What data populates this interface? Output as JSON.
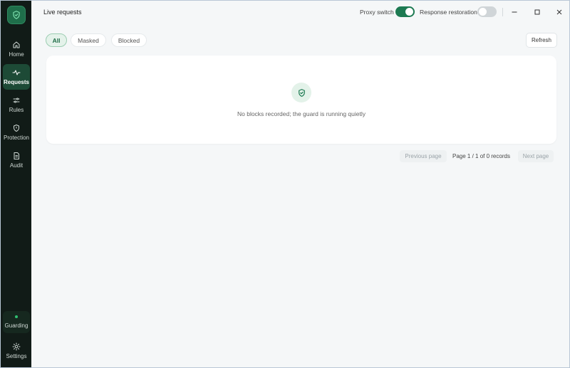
{
  "window": {
    "title": "Live requests",
    "controls": {
      "minimize": "minimize-icon",
      "maximize": "maximize-icon",
      "close": "close-icon"
    }
  },
  "header": {
    "proxy_switch": {
      "label": "Proxy switch",
      "on": true
    },
    "response_restoration": {
      "label": "Response restoration",
      "on": false
    }
  },
  "sidebar": {
    "items": [
      {
        "label": "Home",
        "icon": "home-icon",
        "active": false
      },
      {
        "label": "Requests",
        "icon": "activity-icon",
        "active": true
      },
      {
        "label": "Rules",
        "icon": "sliders-icon",
        "active": false
      },
      {
        "label": "Protection",
        "icon": "shield-icon",
        "active": false
      },
      {
        "label": "Audit",
        "icon": "document-icon",
        "active": false
      }
    ],
    "status": {
      "label": "Guarding"
    },
    "settings": {
      "label": "Settings",
      "icon": "sun-gear-icon"
    }
  },
  "filters": {
    "tabs": [
      {
        "label": "All",
        "active": true
      },
      {
        "label": "Masked",
        "active": false
      },
      {
        "label": "Blocked",
        "active": false
      }
    ],
    "refresh_label": "Refresh"
  },
  "empty_state": {
    "icon": "shield-check-icon",
    "message": "No blocks recorded; the guard is running quietly"
  },
  "pagination": {
    "previous_label": "Previous page",
    "info": "Page 1 / 1 of 0 records",
    "next_label": "Next page"
  },
  "colors": {
    "accent": "#1d7a52",
    "sidebar_bg": "#111b17",
    "active_nav_bg": "#1d4a36",
    "status_dot": "#2fbf71"
  }
}
